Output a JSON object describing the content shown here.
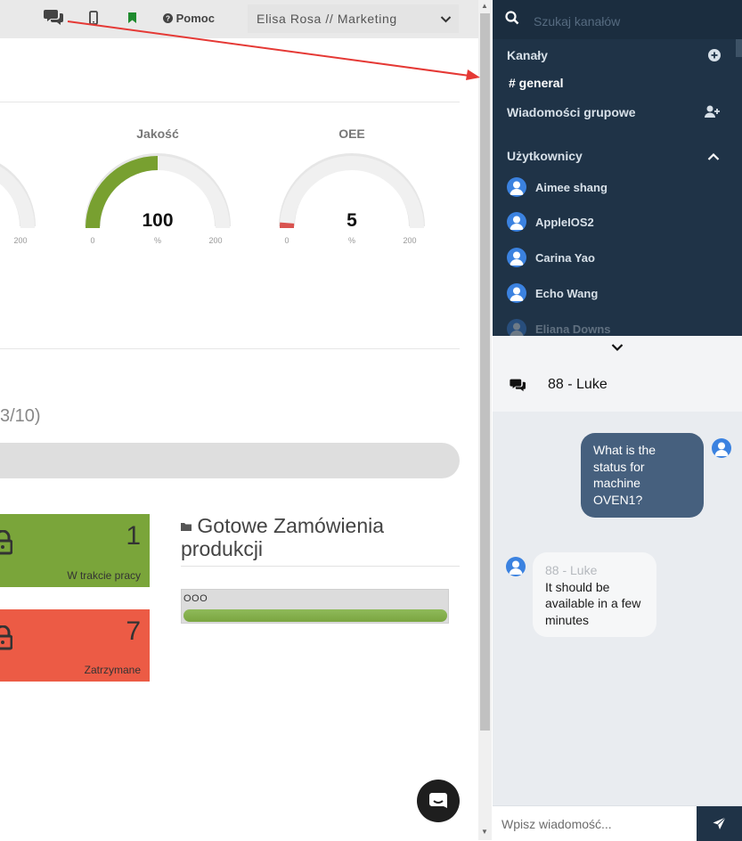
{
  "header": {
    "help_label": "Pomoc",
    "user_label": "Elisa Rosa // Marketing",
    "icons": [
      "chat-icon",
      "mobile-icon",
      "bookmark-icon",
      "help-icon",
      "chevron-down-icon"
    ]
  },
  "gauges": [
    {
      "title": "",
      "value": "",
      "unit": "",
      "min": "",
      "max": "200"
    },
    {
      "title": "Jakość",
      "value": "100",
      "unit": "%",
      "min": "0",
      "max": "200",
      "fraction": 0.5,
      "color": "#78a030"
    },
    {
      "title": "OEE",
      "value": "5",
      "unit": "%",
      "min": "0",
      "max": "200",
      "fraction": 0.025,
      "color": "#d9534f"
    }
  ],
  "progress": {
    "text": "3/10)"
  },
  "tiles": [
    {
      "count": "1",
      "label": "W trakcie pracy",
      "color": "#7aa53a"
    },
    {
      "count": "7",
      "label": "Zatrzymane",
      "color": "#ec5b45"
    }
  ],
  "orders": {
    "title": "Gotowe Zamówienia produkcji",
    "item_label": "OOO",
    "progress_fraction": 1.0
  },
  "sidebar": {
    "search_placeholder": "Szukaj kanałów",
    "channels_heading": "Kanały",
    "channels": [
      "# general"
    ],
    "group_messages_heading": "Wiadomości grupowe",
    "users_heading": "Użytkownicy",
    "users": [
      "Aimee shang",
      "AppleIOS2",
      "Carina Yao",
      "Echo Wang",
      "Eliana Downs"
    ]
  },
  "chat": {
    "title": "88 - Luke",
    "messages": [
      {
        "direction": "out",
        "text": "What is the status for machine OVEN1?"
      },
      {
        "direction": "in",
        "author": "88 - Luke",
        "text": "It should be available in a few minutes"
      }
    ],
    "input_placeholder": "Wpisz wiadomość..."
  },
  "colors": {
    "sidebar_bg": "#1f3347",
    "accent_blue": "#3b82e0",
    "outgoing_bubble": "#46607e",
    "annotation_arrow": "#e53935"
  }
}
